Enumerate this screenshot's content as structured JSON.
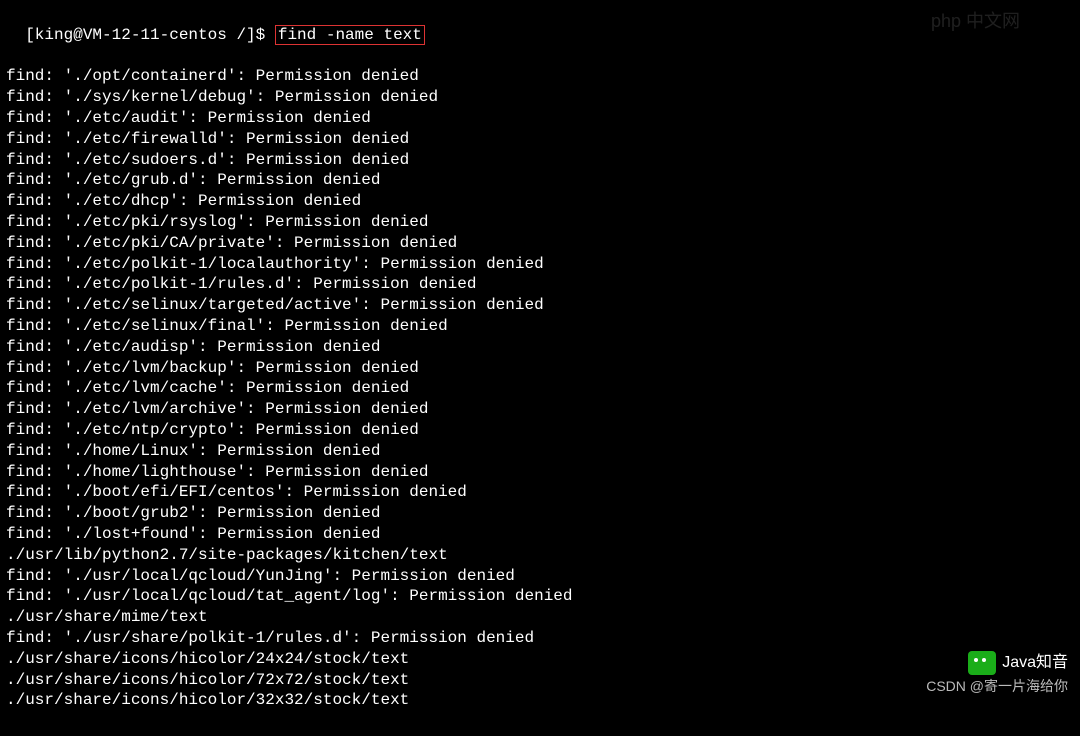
{
  "prompt": {
    "user_host": "[king@VM-12-11-centos /]$ ",
    "command": "find -name text"
  },
  "output_lines": [
    "find: './opt/containerd': Permission denied",
    "find: './sys/kernel/debug': Permission denied",
    "find: './etc/audit': Permission denied",
    "find: './etc/firewalld': Permission denied",
    "find: './etc/sudoers.d': Permission denied",
    "find: './etc/grub.d': Permission denied",
    "find: './etc/dhcp': Permission denied",
    "find: './etc/pki/rsyslog': Permission denied",
    "find: './etc/pki/CA/private': Permission denied",
    "find: './etc/polkit-1/localauthority': Permission denied",
    "find: './etc/polkit-1/rules.d': Permission denied",
    "find: './etc/selinux/targeted/active': Permission denied",
    "find: './etc/selinux/final': Permission denied",
    "find: './etc/audisp': Permission denied",
    "find: './etc/lvm/backup': Permission denied",
    "find: './etc/lvm/cache': Permission denied",
    "find: './etc/lvm/archive': Permission denied",
    "find: './etc/ntp/crypto': Permission denied",
    "find: './home/Linux': Permission denied",
    "find: './home/lighthouse': Permission denied",
    "find: './boot/efi/EFI/centos': Permission denied",
    "find: './boot/grub2': Permission denied",
    "find: './lost+found': Permission denied",
    "./usr/lib/python2.7/site-packages/kitchen/text",
    "find: './usr/local/qcloud/YunJing': Permission denied",
    "find: './usr/local/qcloud/tat_agent/log': Permission denied",
    "./usr/share/mime/text",
    "find: './usr/share/polkit-1/rules.d': Permission denied",
    "./usr/share/icons/hicolor/24x24/stock/text",
    "./usr/share/icons/hicolor/72x72/stock/text",
    "./usr/share/icons/hicolor/32x32/stock/text"
  ],
  "watermarks": {
    "php": "php 中文网",
    "wechat_label": "Java知音",
    "csdn": "CSDN @寄一片海给你"
  }
}
